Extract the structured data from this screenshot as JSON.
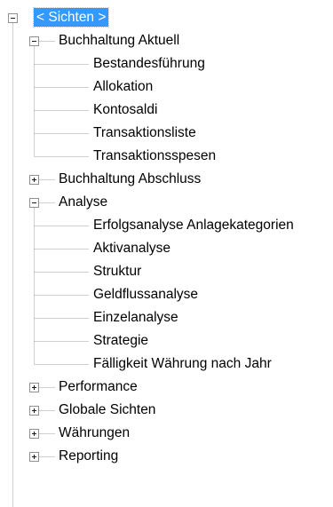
{
  "tree": {
    "root": {
      "label": "< Sichten >",
      "expanded": true,
      "selected": true
    },
    "nodes": [
      {
        "label": "Buchhaltung Aktuell",
        "level": 1,
        "expanded": true,
        "icon": "minus-toggle-icon"
      },
      {
        "label": "Bestandesführung",
        "level": 2
      },
      {
        "label": "Allokation",
        "level": 2
      },
      {
        "label": "Kontosaldi",
        "level": 2
      },
      {
        "label": "Transaktionsliste",
        "level": 2
      },
      {
        "label": "Transaktionsspesen",
        "level": 2
      },
      {
        "label": "Buchhaltung Abschluss",
        "level": 1,
        "expanded": false,
        "icon": "plus-toggle-icon"
      },
      {
        "label": "Analyse",
        "level": 1,
        "expanded": true,
        "icon": "minus-toggle-icon"
      },
      {
        "label": "Erfolgsanalyse Anlagekategorien",
        "level": 2
      },
      {
        "label": "Aktivanalyse",
        "level": 2
      },
      {
        "label": "Struktur",
        "level": 2
      },
      {
        "label": "Geldflussanalyse",
        "level": 2
      },
      {
        "label": "Einzelanalyse",
        "level": 2
      },
      {
        "label": "Strategie",
        "level": 2
      },
      {
        "label": "Fälligkeit Währung nach Jahr",
        "level": 2
      },
      {
        "label": "Performance",
        "level": 1,
        "expanded": false,
        "icon": "plus-toggle-icon"
      },
      {
        "label": "Globale Sichten",
        "level": 1,
        "expanded": false,
        "icon": "plus-toggle-icon"
      },
      {
        "label": "Währungen",
        "level": 1,
        "expanded": false,
        "icon": "plus-toggle-icon"
      },
      {
        "label": "Reporting",
        "level": 1,
        "expanded": false,
        "icon": "plus-toggle-icon"
      }
    ]
  },
  "colors": {
    "selection": "#3399ff",
    "selection_text": "#ffffff",
    "connector_lines": "#a0a0a0",
    "toggle_border": "#919191"
  }
}
